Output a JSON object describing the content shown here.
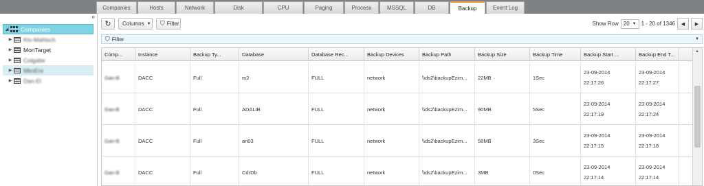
{
  "tabs": [
    {
      "label": "Companies"
    },
    {
      "label": "Hosts"
    },
    {
      "label": "Network"
    },
    {
      "label": "Disk"
    },
    {
      "label": "CPU"
    },
    {
      "label": "Paging"
    },
    {
      "label": "Process"
    },
    {
      "label": "MSSQL"
    },
    {
      "label": "DB"
    },
    {
      "label": "Backup"
    },
    {
      "label": "Event Log"
    }
  ],
  "sidebar": {
    "collapse_icon": "«",
    "root_label": "Companies",
    "items": [
      {
        "label": "Ktv-Mahlsch"
      },
      {
        "label": "MonTarget"
      },
      {
        "label": "Colgabe"
      },
      {
        "label": "MknEnr"
      },
      {
        "label": "Dan-El"
      }
    ]
  },
  "toolbar": {
    "refresh_glyph": "↻",
    "columns_label": "Columns",
    "filter_label": "Filter",
    "show_row_label": "Show Row",
    "rows_per_page": "20",
    "range_text": "1 - 20 of 1346",
    "prev_glyph": "◀",
    "next_glyph": "▶"
  },
  "filterbar": {
    "label": "Filter"
  },
  "grid": {
    "headers": [
      "Comp...",
      "Instance",
      "Backup Ty...",
      "Database",
      "Database Rec...",
      "Backup Devices",
      "Backup Path",
      "Backup Size",
      "Backup Time",
      "Backup Start ...",
      "Backup End T..."
    ],
    "rows": [
      {
        "company": "Gan-B",
        "instance": "DACC",
        "type": "Full",
        "database": "m2",
        "recovery": "FULL",
        "device": "network",
        "path": "\\\\ds2\\backupEzim...",
        "size": "22MB",
        "time": "1Sec",
        "start_date": "23-09-2014",
        "start_time": "22:17:26",
        "end_date": "23-09-2014",
        "end_time": "22:17:27"
      },
      {
        "company": "Gan-B",
        "instance": "DACC",
        "type": "Full",
        "database": "ADALIB",
        "recovery": "FULL",
        "device": "network",
        "path": "\\\\ds2\\backupEzim...",
        "size": "90MB",
        "time": "5Sec",
        "start_date": "23-09-2014",
        "start_time": "22:17:19",
        "end_date": "23-09-2014",
        "end_time": "22:17:24"
      },
      {
        "company": "Gan-B",
        "instance": "DACC",
        "type": "Full",
        "database": "ari03",
        "recovery": "FULL",
        "device": "network",
        "path": "\\\\ds2\\backupEzim...",
        "size": "58MB",
        "time": "3Sec",
        "start_date": "23-09-2014",
        "start_time": "22:17:15",
        "end_date": "23-09-2014",
        "end_time": "22:17:18"
      },
      {
        "company": "Gan-B",
        "instance": "DACC",
        "type": "Full",
        "database": "CdrDb",
        "recovery": "FULL",
        "device": "network",
        "path": "\\\\ds2\\backupEzim...",
        "size": "3MB",
        "time": "0Sec",
        "start_date": "23-09-2014",
        "start_time": "22:17:14",
        "end_date": "23-09-2014",
        "end_time": "22:17:14"
      }
    ]
  },
  "colors": {
    "accent_tab": "#f0a040",
    "tree_selected": "#7fd4e4",
    "filterbar": "#eef7fb"
  }
}
